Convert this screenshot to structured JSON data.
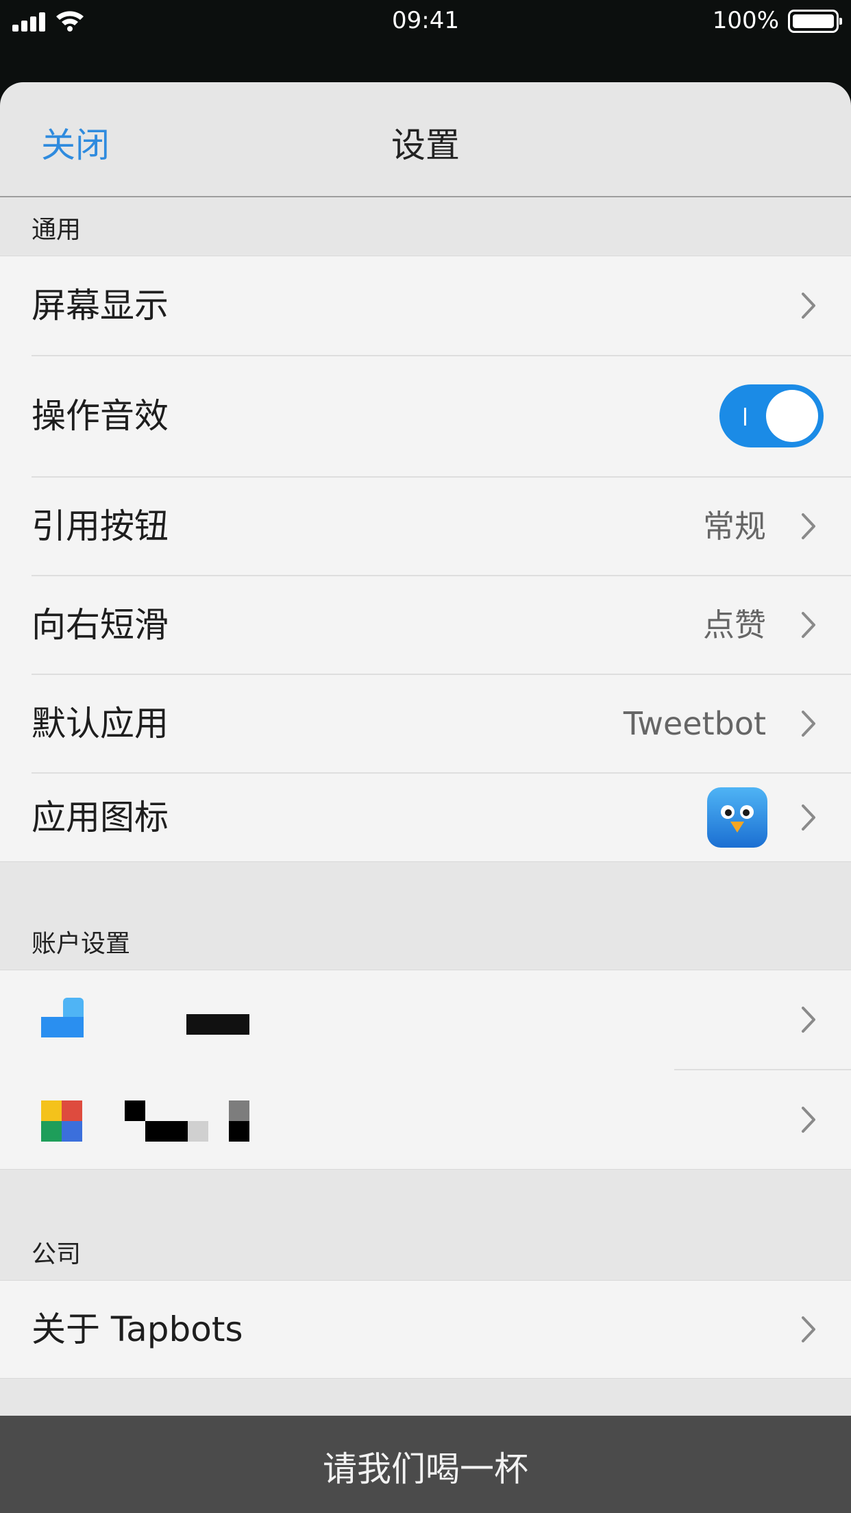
{
  "status_bar": {
    "time": "09:41",
    "battery": "100%"
  },
  "nav": {
    "close_label": "关闭",
    "title": "设置"
  },
  "sections": {
    "general": {
      "header": "通用",
      "rows": [
        {
          "label": "屏幕显示"
        },
        {
          "label": "操作音效",
          "toggle": true
        },
        {
          "label": "引用按钮",
          "value": "常规"
        },
        {
          "label": "向右短滑",
          "value": "点赞"
        },
        {
          "label": "默认应用",
          "value": "Tweetbot"
        },
        {
          "label": "应用图标",
          "icon": "tweetbot-app-icon"
        }
      ]
    },
    "accounts": {
      "header": "账户设置",
      "rows": [
        {
          "icon": "account-avatar-icon-1"
        },
        {
          "icon": "account-avatar-icon-2"
        }
      ]
    },
    "company": {
      "header": "公司",
      "rows": [
        {
          "label": "关于 Tapbots"
        }
      ]
    }
  },
  "buy_button": {
    "label": "请我们喝一杯"
  },
  "colors": {
    "accent": "#2f8bde",
    "toggle_on": "#1b8be6"
  }
}
